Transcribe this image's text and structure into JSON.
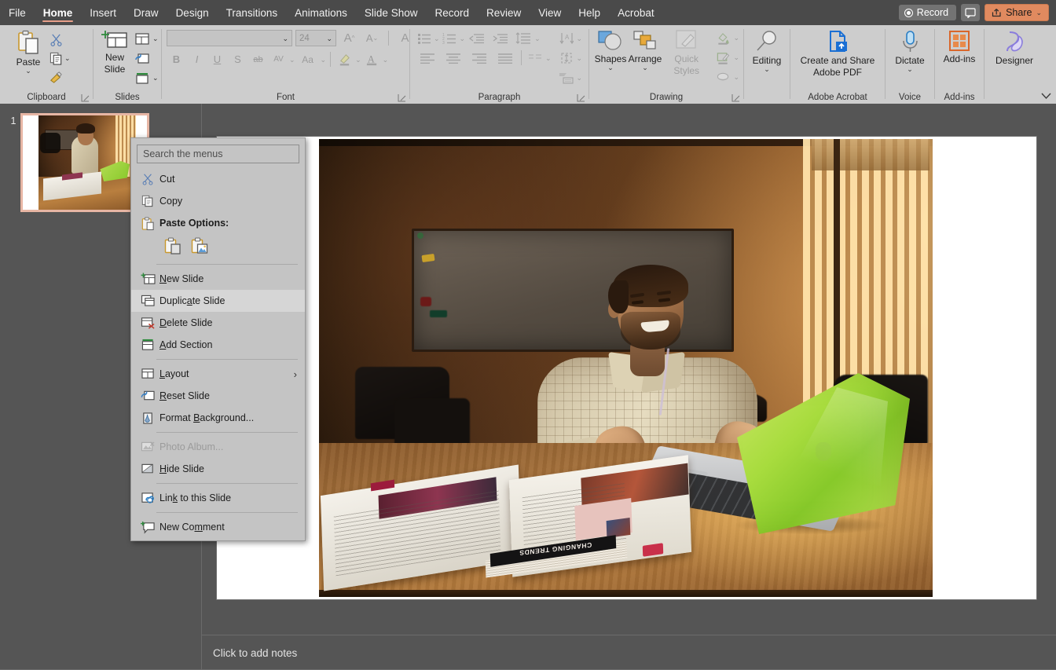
{
  "app": {
    "tabs": [
      {
        "label": "File",
        "active": false
      },
      {
        "label": "Home",
        "active": true
      },
      {
        "label": "Insert",
        "active": false
      },
      {
        "label": "Draw",
        "active": false
      },
      {
        "label": "Design",
        "active": false
      },
      {
        "label": "Transitions",
        "active": false
      },
      {
        "label": "Animations",
        "active": false
      },
      {
        "label": "Slide Show",
        "active": false
      },
      {
        "label": "Record",
        "active": false
      },
      {
        "label": "Review",
        "active": false
      },
      {
        "label": "View",
        "active": false
      },
      {
        "label": "Help",
        "active": false
      },
      {
        "label": "Acrobat",
        "active": false
      }
    ],
    "titlebar_right": {
      "record_label": "Record",
      "share_label": "Share",
      "share_color": "#e08a5f"
    }
  },
  "ribbon": {
    "groups": [
      {
        "name": "Clipboard",
        "label": "Clipboard"
      },
      {
        "name": "Slides",
        "label": "Slides"
      },
      {
        "name": "Font",
        "label": "Font"
      },
      {
        "name": "Paragraph",
        "label": "Paragraph"
      },
      {
        "name": "Drawing",
        "label": "Drawing"
      },
      {
        "name": "Editing",
        "label": ""
      },
      {
        "name": "Adobe Acrobat",
        "label": "Adobe Acrobat"
      },
      {
        "name": "Voice",
        "label": "Voice"
      },
      {
        "name": "Add-ins",
        "label": "Add-ins"
      },
      {
        "name": "Designer",
        "label": ""
      }
    ],
    "clipboard": {
      "paste_label": "Paste",
      "cut_icon": "scissors-icon",
      "copy_icon": "copy-icon",
      "format_painter_icon": "format-painter-icon"
    },
    "slides": {
      "new_slide_label": "New Slide",
      "layout_icon": "layout-icon",
      "reset_icon": "reset-slide-icon",
      "section_icon": "section-icon"
    },
    "font": {
      "font_name_value": "",
      "font_size_value": "24",
      "grow_font": "A",
      "shrink_font": "A",
      "clear_formatting": "A",
      "bold": "B",
      "italic": "I",
      "underline": "U",
      "shadow": "S",
      "strikethrough": "ab",
      "char_spacing": "AV",
      "change_case": "Aa"
    },
    "drawing": {
      "shapes_label": "Shapes",
      "arrange_label": "Arrange",
      "quick_styles_label": "Quick Styles"
    },
    "editing": {
      "label": "Editing"
    },
    "acrobat": {
      "label": "Create and Share Adobe PDF"
    },
    "voice": {
      "label": "Dictate"
    },
    "addins": {
      "label": "Add-ins"
    },
    "designer": {
      "label": "Designer"
    }
  },
  "thumbnails": {
    "slides": [
      {
        "number": "1",
        "selected": true
      }
    ],
    "selection_color": "#e7b6a4"
  },
  "slide": {
    "photo_alt": "Man in checked shirt gesturing at a laptop with an open magazine on a wooden desk",
    "magazine_text": "CHANGING TRENDS"
  },
  "notes": {
    "placeholder": "Click to add notes"
  },
  "context_menu": {
    "search_placeholder": "Search the menus",
    "items": [
      {
        "label": "Cut",
        "icon": "cut-icon",
        "accel": "t",
        "disabled": false,
        "bold": false,
        "highlight": false,
        "submenu": false
      },
      {
        "label": "Copy",
        "icon": "copy-icon",
        "accel": "C",
        "disabled": false,
        "bold": false,
        "highlight": false,
        "submenu": false
      },
      {
        "label": "Paste Options:",
        "icon": "paste-icon",
        "accel": "",
        "disabled": false,
        "bold": true,
        "highlight": false,
        "submenu": false
      },
      {
        "label": "New Slide",
        "icon": "new-slide-icon",
        "accel": "N",
        "disabled": false,
        "bold": false,
        "highlight": false,
        "submenu": false
      },
      {
        "label": "Duplicate Slide",
        "icon": "duplicate-slide-icon",
        "accel": "a",
        "disabled": false,
        "bold": false,
        "highlight": true,
        "submenu": false
      },
      {
        "label": "Delete Slide",
        "icon": "delete-slide-icon",
        "accel": "D",
        "disabled": false,
        "bold": false,
        "highlight": false,
        "submenu": false
      },
      {
        "label": "Add Section",
        "icon": "add-section-icon",
        "accel": "A",
        "disabled": false,
        "bold": false,
        "highlight": false,
        "submenu": false
      },
      {
        "label": "Layout",
        "icon": "layout-icon",
        "accel": "L",
        "disabled": false,
        "bold": false,
        "highlight": false,
        "submenu": true
      },
      {
        "label": "Reset Slide",
        "icon": "reset-slide-icon",
        "accel": "R",
        "disabled": false,
        "bold": false,
        "highlight": false,
        "submenu": false
      },
      {
        "label": "Format Background...",
        "icon": "format-background-icon",
        "accel": "B",
        "disabled": false,
        "bold": false,
        "highlight": false,
        "submenu": false
      },
      {
        "label": "Photo Album...",
        "icon": "photo-album-icon",
        "accel": "",
        "disabled": true,
        "bold": false,
        "highlight": false,
        "submenu": false
      },
      {
        "label": "Hide Slide",
        "icon": "hide-slide-icon",
        "accel": "H",
        "disabled": false,
        "bold": false,
        "highlight": false,
        "submenu": false
      },
      {
        "label": "Link to this Slide",
        "icon": "link-slide-icon",
        "accel": "k",
        "disabled": false,
        "bold": false,
        "highlight": false,
        "submenu": false
      },
      {
        "label": "New Comment",
        "icon": "new-comment-icon",
        "accel": "m",
        "disabled": false,
        "bold": false,
        "highlight": false,
        "submenu": false
      }
    ],
    "paste_options": [
      {
        "name": "paste-use-destination-theme-icon"
      },
      {
        "name": "paste-picture-icon"
      }
    ],
    "highlight_color": "#d6d6d6"
  }
}
